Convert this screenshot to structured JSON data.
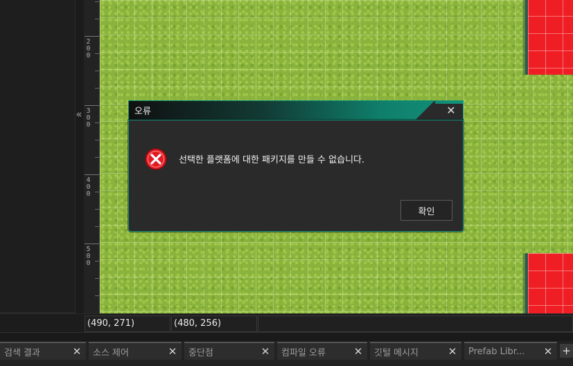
{
  "dialog": {
    "title": "오류",
    "message": "선택한 플랫폼에 대한 패키지를 만들 수 없습니다.",
    "ok_label": "확인",
    "close_glyph": "✕"
  },
  "ruler": {
    "labels": [
      "200",
      "300",
      "400",
      "500"
    ]
  },
  "panel": {
    "collapse_glyph": "«"
  },
  "status": {
    "coord_a": "(490, 271)",
    "coord_b": "(480, 256)",
    "coord_c": ""
  },
  "tabs": [
    {
      "label": "검색 결과"
    },
    {
      "label": "소스 제어"
    },
    {
      "label": "중단점"
    },
    {
      "label": "컴파일 오류"
    },
    {
      "label": "깃털 메시지"
    },
    {
      "label": "Prefab Libr..."
    }
  ],
  "tab_close_glyph": "✕",
  "tab_add_glyph": "+",
  "colors": {
    "accent": "#12927a",
    "error_red": "#e21b23",
    "grass": "#8ab33d",
    "wall": "#ee1e24"
  },
  "icons": {
    "error": "error-x-circle-icon",
    "close": "close-icon",
    "collapse": "double-chevron-left-icon",
    "add": "plus-icon"
  }
}
